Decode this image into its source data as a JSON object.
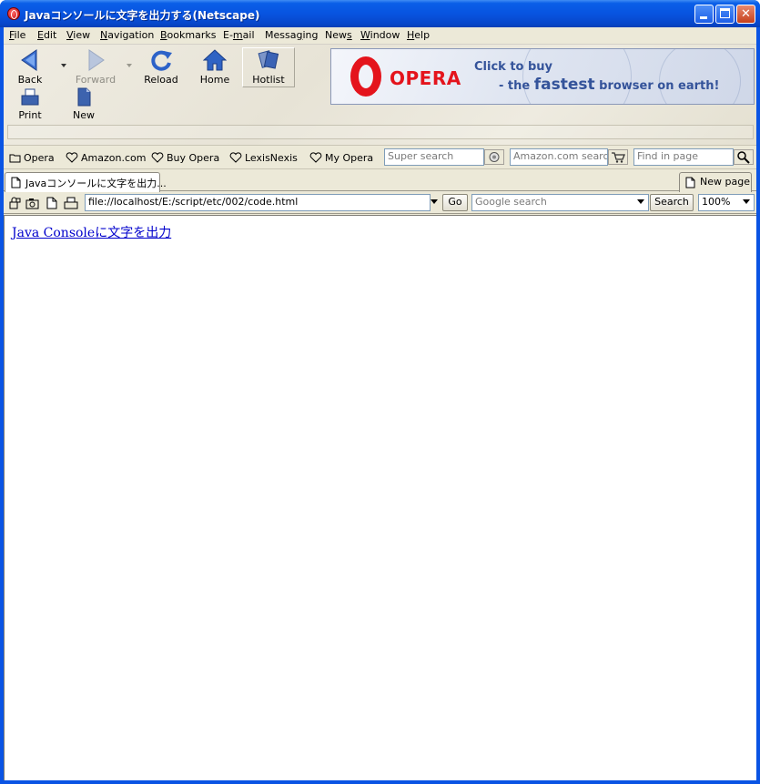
{
  "window": {
    "title": "Javaコンソールに文字を出力する(Netscape)"
  },
  "menubar": {
    "items": [
      {
        "key": "F",
        "rest": "ile"
      },
      {
        "key": "E",
        "rest": "dit"
      },
      {
        "key": "V",
        "rest": "iew"
      },
      {
        "key": "N",
        "rest": "avigation"
      },
      {
        "key": "B",
        "rest": "ookmarks"
      },
      {
        "pre": "E-",
        "key": "m",
        "rest": "ail"
      },
      {
        "pre": "Messa",
        "key": "g",
        "rest": "ing"
      },
      {
        "pre": "New",
        "key": "s",
        "rest": ""
      },
      {
        "key": "W",
        "rest": "indow"
      },
      {
        "key": "H",
        "rest": "elp"
      }
    ]
  },
  "toolbar": {
    "back": "Back",
    "forward": "Forward",
    "reload": "Reload",
    "home": "Home",
    "hotlist": "Hotlist",
    "print": "Print",
    "new": "New"
  },
  "banner": {
    "brand": "OPERA",
    "line1": "Click to buy",
    "line2_pre": "- the ",
    "line2_big": "fastest",
    "line2_post": " browser on earth!",
    "brand_color": "#e4141c",
    "text_color": "#34539a"
  },
  "personalbar": {
    "items": [
      "Opera",
      "Amazon.com",
      "Buy Opera",
      "LexisNexis",
      "My Opera"
    ],
    "super_search_placeholder": "Super search",
    "amazon_search_placeholder": "Amazon.com search",
    "find_placeholder": "Find in page"
  },
  "tabs": {
    "active": "Javaコンソールに文字を出力...",
    "new_page": "New page"
  },
  "address": {
    "url": "file://localhost/E:/script/etc/002/code.html",
    "go": "Go",
    "google_placeholder": "Google search",
    "search": "Search",
    "zoom": "100%"
  },
  "content": {
    "link_text": "Java Consoleに文字を出力",
    "link_color": "#0000cc"
  }
}
